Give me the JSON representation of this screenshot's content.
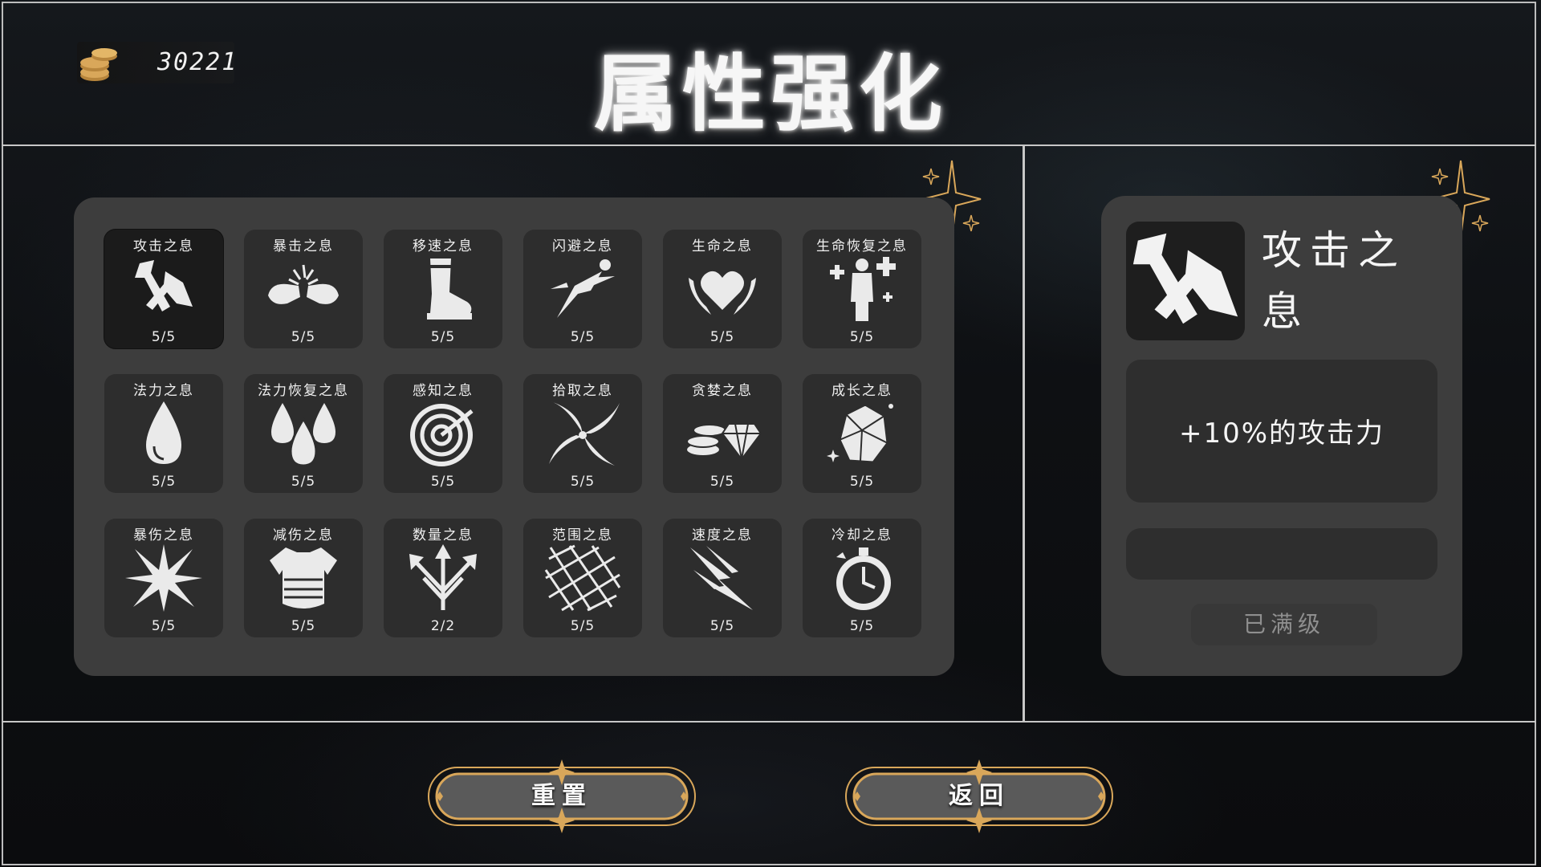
{
  "header": {
    "coin_count": "30221",
    "title": "属性强化"
  },
  "skills": [
    {
      "name": "攻击之息",
      "level": "5/5",
      "icon": "axe-icon"
    },
    {
      "name": "暴击之息",
      "level": "5/5",
      "icon": "fist-clash-icon"
    },
    {
      "name": "移速之息",
      "level": "5/5",
      "icon": "boot-icon"
    },
    {
      "name": "闪避之息",
      "level": "5/5",
      "icon": "dodge-runner-icon"
    },
    {
      "name": "生命之息",
      "level": "5/5",
      "icon": "heart-icon"
    },
    {
      "name": "生命恢复之息",
      "level": "5/5",
      "icon": "healing-person-icon"
    },
    {
      "name": "法力之息",
      "level": "5/5",
      "icon": "mana-drop-icon"
    },
    {
      "name": "法力恢复之息",
      "level": "5/5",
      "icon": "mana-drops-icon"
    },
    {
      "name": "感知之息",
      "level": "5/5",
      "icon": "radar-icon"
    },
    {
      "name": "拾取之息",
      "level": "5/5",
      "icon": "vortex-icon"
    },
    {
      "name": "贪婪之息",
      "level": "5/5",
      "icon": "coins-gem-icon"
    },
    {
      "name": "成长之息",
      "level": "5/5",
      "icon": "crystal-rock-icon"
    },
    {
      "name": "暴伤之息",
      "level": "5/5",
      "icon": "burst-icon"
    },
    {
      "name": "减伤之息",
      "level": "5/5",
      "icon": "armor-icon"
    },
    {
      "name": "数量之息",
      "level": "2/2",
      "icon": "split-arrows-icon"
    },
    {
      "name": "范围之息",
      "level": "5/5",
      "icon": "net-icon"
    },
    {
      "name": "速度之息",
      "level": "5/5",
      "icon": "speed-streak-icon"
    },
    {
      "name": "冷却之息",
      "level": "5/5",
      "icon": "stopwatch-icon"
    }
  ],
  "detail": {
    "name": "攻击之息",
    "icon": "axe-icon",
    "description": "+10%的攻击力",
    "cost": "",
    "status_label": "已满级"
  },
  "buttons": {
    "reset_label": "重置",
    "back_label": "返回"
  },
  "colors": {
    "panel": "#3d3d3d",
    "tile": "#2d2d2d",
    "selected_tile": "#1b1b1b",
    "gold": "#d9a75a"
  }
}
